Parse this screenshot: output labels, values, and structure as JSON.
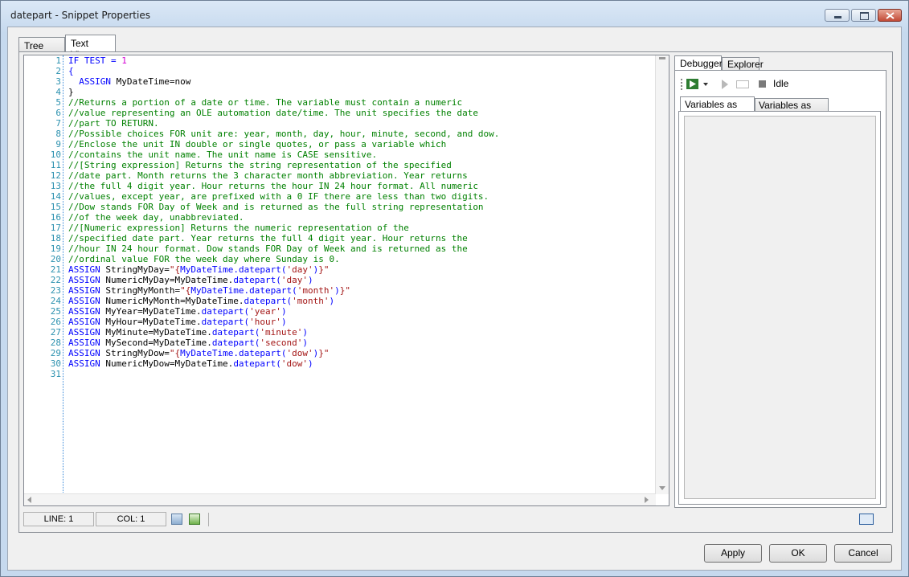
{
  "window": {
    "title": "datepart - Snippet Properties",
    "accent": "#c24a36"
  },
  "tabs": {
    "tree_view": "Tree View",
    "text_view": "Text View"
  },
  "editor": {
    "lines": [
      {
        "n": "1",
        "parts": [
          [
            "kw",
            "IF TEST = "
          ],
          [
            "num",
            "1"
          ]
        ]
      },
      {
        "n": "2",
        "parts": [
          [
            "kw",
            "{"
          ]
        ]
      },
      {
        "n": "3",
        "parts": [
          [
            "kw",
            "  ASSIGN "
          ],
          [
            "nm",
            "MyDateTime=now"
          ]
        ]
      },
      {
        "n": "4",
        "parts": [
          [
            "nm",
            "}"
          ]
        ]
      },
      {
        "n": "5",
        "parts": [
          [
            "cm",
            "//Returns a portion of a date or time. The variable must contain a numeric"
          ]
        ]
      },
      {
        "n": "6",
        "parts": [
          [
            "cm",
            "//value representing an OLE automation date/time. The unit specifies the date"
          ]
        ]
      },
      {
        "n": "7",
        "parts": [
          [
            "cm",
            "//part TO RETURN."
          ]
        ]
      },
      {
        "n": "8",
        "parts": [
          [
            "cm",
            "//Possible choices FOR unit are: year, month, day, hour, minute, second, and dow."
          ]
        ]
      },
      {
        "n": "9",
        "parts": [
          [
            "cm",
            "//Enclose the unit IN double or single quotes, or pass a variable which"
          ]
        ]
      },
      {
        "n": "10",
        "parts": [
          [
            "cm",
            "//contains the unit name. The unit name is CASE sensitive."
          ]
        ]
      },
      {
        "n": "11",
        "parts": [
          [
            "cm",
            "//[String expression] Returns the string representation of the specified"
          ]
        ]
      },
      {
        "n": "12",
        "parts": [
          [
            "cm",
            "//date part. Month returns the 3 character month abbreviation. Year returns"
          ]
        ]
      },
      {
        "n": "13",
        "parts": [
          [
            "cm",
            "//the full 4 digit year. Hour returns the hour IN 24 hour format. All numeric"
          ]
        ]
      },
      {
        "n": "14",
        "parts": [
          [
            "cm",
            "//values, except year, are prefixed with a 0 IF there are less than two digits."
          ]
        ]
      },
      {
        "n": "15",
        "parts": [
          [
            "cm",
            "//Dow stands FOR Day of Week and is returned as the full string representation"
          ]
        ]
      },
      {
        "n": "16",
        "parts": [
          [
            "cm",
            "//of the week day, unabbreviated."
          ]
        ]
      },
      {
        "n": "17",
        "parts": [
          [
            "cm",
            "//[Numeric expression] Returns the numeric representation of the"
          ]
        ]
      },
      {
        "n": "18",
        "parts": [
          [
            "cm",
            "//specified date part. Year returns the full 4 digit year. Hour returns the"
          ]
        ]
      },
      {
        "n": "19",
        "parts": [
          [
            "cm",
            "//hour IN 24 hour format. Dow stands FOR Day of Week and is returned as the"
          ]
        ]
      },
      {
        "n": "20",
        "parts": [
          [
            "cm",
            "//ordinal value FOR the week day where Sunday is 0."
          ]
        ]
      },
      {
        "n": "21",
        "parts": [
          [
            "kw",
            "ASSIGN "
          ],
          [
            "nm",
            "StringMyDay="
          ],
          [
            "st",
            "\"{"
          ],
          [
            "kw",
            "MyDateTime.datepart("
          ],
          [
            "st",
            "'day'"
          ],
          [
            "kw",
            ")"
          ],
          [
            "st",
            "}\""
          ]
        ]
      },
      {
        "n": "22",
        "parts": [
          [
            "kw",
            "ASSIGN "
          ],
          [
            "nm",
            "NumericMyDay=MyDateTime."
          ],
          [
            "kw",
            "datepart("
          ],
          [
            "st",
            "'day'"
          ],
          [
            "kw",
            ")"
          ]
        ]
      },
      {
        "n": "23",
        "parts": [
          [
            "kw",
            "ASSIGN "
          ],
          [
            "nm",
            "StringMyMonth="
          ],
          [
            "st",
            "\"{"
          ],
          [
            "kw",
            "MyDateTime.datepart("
          ],
          [
            "st",
            "'month'"
          ],
          [
            "kw",
            ")"
          ],
          [
            "st",
            "}\""
          ]
        ]
      },
      {
        "n": "24",
        "parts": [
          [
            "kw",
            "ASSIGN "
          ],
          [
            "nm",
            "NumericMyMonth=MyDateTime."
          ],
          [
            "kw",
            "datepart("
          ],
          [
            "st",
            "'month'"
          ],
          [
            "kw",
            ")"
          ]
        ]
      },
      {
        "n": "25",
        "parts": [
          [
            "kw",
            "ASSIGN "
          ],
          [
            "nm",
            "MyYear=MyDateTime."
          ],
          [
            "kw",
            "datepart("
          ],
          [
            "st",
            "'year'"
          ],
          [
            "kw",
            ")"
          ]
        ]
      },
      {
        "n": "26",
        "parts": [
          [
            "kw",
            "ASSIGN "
          ],
          [
            "nm",
            "MyHour=MyDateTime."
          ],
          [
            "kw",
            "datepart("
          ],
          [
            "st",
            "'hour'"
          ],
          [
            "kw",
            ")"
          ]
        ]
      },
      {
        "n": "27",
        "parts": [
          [
            "kw",
            "ASSIGN "
          ],
          [
            "nm",
            "MyMinute=MyDateTime."
          ],
          [
            "kw",
            "datepart("
          ],
          [
            "st",
            "'minute'"
          ],
          [
            "kw",
            ")"
          ]
        ]
      },
      {
        "n": "28",
        "parts": [
          [
            "kw",
            "ASSIGN "
          ],
          [
            "nm",
            "MySecond=MyDateTime."
          ],
          [
            "kw",
            "datepart("
          ],
          [
            "st",
            "'second'"
          ],
          [
            "kw",
            ")"
          ]
        ]
      },
      {
        "n": "29",
        "parts": [
          [
            "kw",
            "ASSIGN "
          ],
          [
            "nm",
            "StringMyDow="
          ],
          [
            "st",
            "\"{"
          ],
          [
            "kw",
            "MyDateTime.datepart("
          ],
          [
            "st",
            "'dow'"
          ],
          [
            "kw",
            ")"
          ],
          [
            "st",
            "}\""
          ]
        ]
      },
      {
        "n": "30",
        "parts": [
          [
            "kw",
            "ASSIGN "
          ],
          [
            "nm",
            "NumericMyDow=MyDateTime."
          ],
          [
            "kw",
            "datepart("
          ],
          [
            "st",
            "'dow'"
          ],
          [
            "kw",
            ")"
          ]
        ]
      },
      {
        "n": "31",
        "parts": []
      }
    ]
  },
  "status": {
    "line": "LINE: 1",
    "col": "COL: 1"
  },
  "debugger": {
    "tab_debugger": "Debugger",
    "tab_explorer": "Explorer",
    "state": "Idle",
    "subtab_text": "Variables as Text",
    "subtab_tree": "Variables as Tree"
  },
  "buttons": {
    "apply": "Apply",
    "ok": "OK",
    "cancel": "Cancel"
  }
}
